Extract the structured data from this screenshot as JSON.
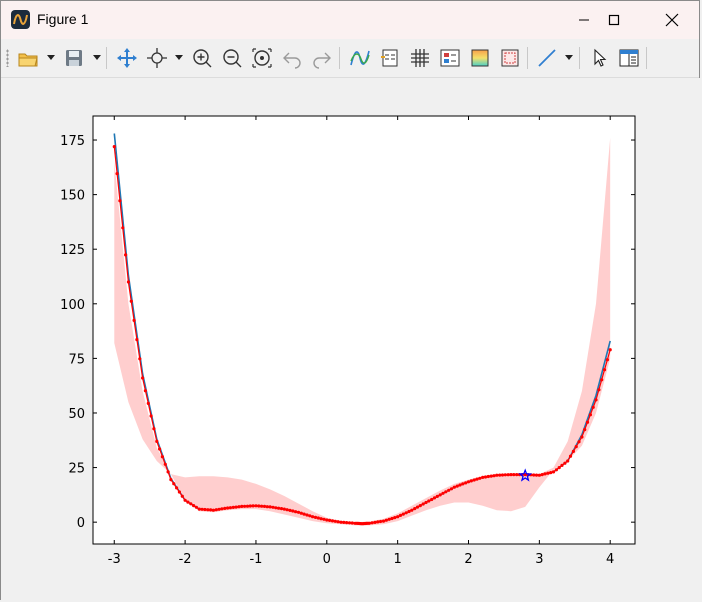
{
  "window": {
    "title": "Figure 1",
    "controls": [
      "minimize-icon",
      "maximize-icon",
      "close-icon"
    ]
  },
  "toolbar": {
    "buttons": [
      "open-folder-icon",
      "save-icon",
      "pan-icon",
      "point-select-icon",
      "zoom-in-icon",
      "zoom-out-icon",
      "zoom-fit-icon",
      "undo-icon",
      "redo-icon",
      "curve-edit-icon",
      "legend-icon",
      "grid-icon",
      "properties-icon",
      "colormap-icon",
      "frame-icon",
      "line-style-icon",
      "cursor-icon",
      "panel-icon"
    ]
  },
  "colors": {
    "curve": "#1f77b4",
    "markers": "#ff0000",
    "band": "#ffb3b3",
    "star": "#0000ff"
  },
  "chart_data": {
    "type": "line",
    "xlim": [
      -3.3,
      4.35
    ],
    "ylim": [
      -10,
      186
    ],
    "xticks": [
      -3,
      -2,
      -1,
      0,
      1,
      2,
      3,
      4
    ],
    "yticks": [
      0,
      25,
      50,
      75,
      100,
      125,
      150,
      175
    ],
    "xtick_labels": [
      "-3",
      "-2",
      "-1",
      "0",
      "1",
      "2",
      "3",
      "4"
    ],
    "ytick_labels": [
      "0",
      "25",
      "50",
      "75",
      "100",
      "125",
      "150",
      "175"
    ],
    "grid": false,
    "series": [
      {
        "kind": "line",
        "color": "#1f77b4",
        "x": [
          -3.0,
          -2.8,
          -2.6,
          -2.4,
          -2.2,
          -2.0,
          -1.8,
          -1.6,
          -1.4,
          -1.2,
          -1.0,
          -0.8,
          -0.6,
          -0.4,
          -0.2,
          0.0,
          0.2,
          0.4,
          0.5,
          0.6,
          0.8,
          1.0,
          1.2,
          1.4,
          1.6,
          1.8,
          2.0,
          2.2,
          2.4,
          2.6,
          2.8,
          3.0,
          3.2,
          3.4,
          3.6,
          3.8,
          4.0
        ],
        "y": [
          178,
          113,
          68,
          38,
          20,
          10,
          6,
          5.5,
          6.5,
          7.2,
          7.5,
          7,
          6,
          4.5,
          2.5,
          1,
          0,
          -0.5,
          -0.7,
          -0.5,
          0.5,
          2.5,
          5.5,
          9,
          12.5,
          16,
          18.5,
          20.5,
          21.5,
          21.8,
          21.8,
          21.5,
          23,
          28,
          40,
          58,
          83
        ]
      },
      {
        "kind": "markers",
        "color": "#ff0000",
        "x": [
          -3.0,
          -2.8,
          -2.6,
          -2.4,
          -2.2,
          -2.0,
          -1.8,
          -1.6,
          -1.4,
          -1.2,
          -1.0,
          -0.8,
          -0.6,
          -0.4,
          -0.2,
          0.0,
          0.2,
          0.4,
          0.5,
          0.6,
          0.8,
          1.0,
          1.2,
          1.4,
          1.6,
          1.8,
          2.0,
          2.2,
          2.4,
          2.6,
          2.8,
          3.0,
          3.2,
          3.4,
          3.6,
          3.8,
          4.0
        ],
        "y": [
          172,
          110,
          66,
          37,
          19.5,
          10,
          6,
          5.5,
          6.5,
          7.2,
          7.5,
          7,
          6,
          4.5,
          2.5,
          1,
          0,
          -0.5,
          -0.7,
          -0.5,
          0.5,
          2.5,
          5.5,
          9,
          12.5,
          16,
          18.5,
          20.5,
          21.5,
          21.8,
          21.8,
          21.5,
          23,
          28,
          39,
          56,
          79
        ]
      }
    ],
    "band": {
      "color": "#ffb3b3",
      "x": [
        -3.0,
        -2.8,
        -2.6,
        -2.4,
        -2.2,
        -2.0,
        -1.8,
        -1.6,
        -1.4,
        -1.2,
        -1.0,
        -0.8,
        -0.6,
        -0.4,
        -0.2,
        0.0,
        0.2,
        0.4,
        0.6,
        0.8,
        1.0,
        1.2,
        1.4,
        1.6,
        1.8,
        2.0,
        2.2,
        2.4,
        2.6,
        2.8,
        3.0,
        3.2,
        3.4,
        3.6,
        3.8,
        4.0
      ],
      "upper": [
        165,
        100,
        60,
        34,
        22,
        20.5,
        21,
        21,
        20.5,
        19.5,
        17.5,
        15,
        12,
        8.5,
        5,
        2,
        0.5,
        0,
        0.3,
        1.5,
        4,
        7.5,
        11,
        14.5,
        17.5,
        19.5,
        21,
        22,
        22.2,
        22,
        22,
        25,
        37,
        60,
        100,
        176
      ],
      "lower": [
        82,
        55,
        38,
        28,
        22,
        10,
        5,
        4.5,
        5.5,
        6,
        6,
        5,
        3.5,
        2,
        0.5,
        -0.5,
        -1,
        -1.5,
        -1.5,
        -1,
        0.5,
        3,
        5.5,
        7.5,
        9,
        9,
        7.5,
        5.5,
        5,
        7,
        16,
        24,
        28,
        35,
        50,
        75
      ]
    },
    "star": {
      "x": 2.8,
      "y": 21.3,
      "color": "#0000ff"
    }
  }
}
